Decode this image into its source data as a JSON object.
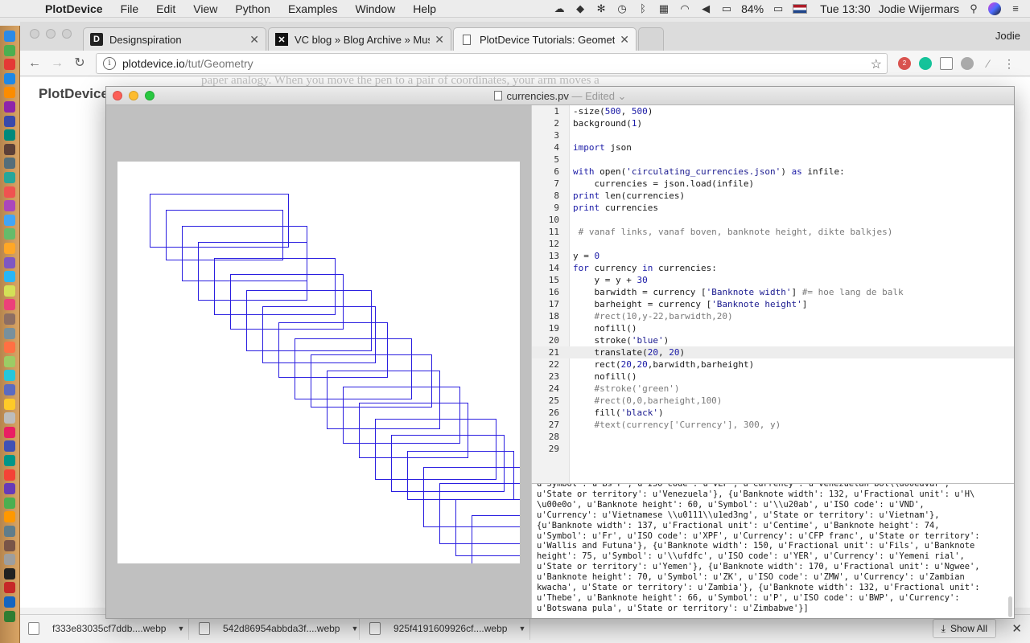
{
  "menubar": {
    "app_name": "PlotDevice",
    "menus": [
      "File",
      "Edit",
      "View",
      "Python",
      "Examples",
      "Window",
      "Help"
    ],
    "battery": "84%",
    "clock": "Tue 13:30",
    "user": "Jodie Wijermars"
  },
  "browser": {
    "tabs": [
      {
        "title": "Designspiration",
        "favicon": "D"
      },
      {
        "title": "VC blog » Blog Archive » Musi",
        "favicon": "✕"
      },
      {
        "title": "PlotDevice Tutorials: Geometry",
        "favicon": "doc"
      }
    ],
    "profile": "Jodie",
    "url_host": "plotdevice.io",
    "url_path": "/tut/Geometry",
    "badge": "2"
  },
  "webpage": {
    "logo": "PlotDevice",
    "background_text": "paper analogy. When you move the pen to a pair of coordinates, your arm moves a"
  },
  "plotdevice": {
    "filename": "currencies.pv",
    "edited_label": " — Edited",
    "code": [
      "-size(500, 500)",
      "background(1)",
      "",
      "import json",
      "",
      "with open('circulating_currencies.json') as infile:",
      "    currencies = json.load(infile)",
      "print len(currencies)",
      "print currencies",
      "",
      " # vanaf links, vanaf boven, banknote height, dikte balkjes)",
      "",
      "y = 0",
      "for currency in currencies:",
      "    y = y + 30",
      "    barwidth = currency ['Banknote width'] #= hoe lang de balk",
      "    barheight = currency ['Banknote height']",
      "    #rect(10,y-22,barwidth,20)",
      "    nofill()",
      "    stroke('blue')",
      "    translate(20, 20)",
      "    rect(20,20,barwidth,barheight)",
      "    nofill()",
      "    #stroke('green')",
      "    #rect(0,0,barheight,100)",
      "    fill('black')",
      "    #text(currency['Currency'], 300, y)",
      "",
      ""
    ],
    "highlight_line": 21,
    "console": [
      "u'Symbol': u'Bs F', u'ISO code': u'VEF', u'Currency': u'Venezuelan bol\\\\u00edvar',",
      "u'State or territory': u'Venezuela'}, {u'Banknote width': 132, u'Fractional unit': u'H\\",
      "\\u00e0o', u'Banknote height': 60, u'Symbol': u'\\\\u20ab', u'ISO code': u'VND',",
      "u'Currency': u'Vietnamese \\\\u0111\\\\u1ed3ng', u'State or territory': u'Vietnam'},",
      "{u'Banknote width': 137, u'Fractional unit': u'Centime', u'Banknote height': 74,",
      "u'Symbol': u'Fr', u'ISO code': u'XPF', u'Currency': u'CFP franc', u'State or territory':",
      "u'Wallis and Futuna'}, {u'Banknote width': 150, u'Fractional unit': u'Fils', u'Banknote",
      "height': 75, u'Symbol': u'\\\\ufdfc', u'ISO code': u'YER', u'Currency': u'Yemeni rial',",
      "u'State or territory': u'Yemen'}, {u'Banknote width': 170, u'Fractional unit': u'Ngwee',",
      "u'Banknote height': 70, u'Symbol': u'ZK', u'ISO code': u'ZMW', u'Currency': u'Zambian",
      "kwacha', u'State or territory': u'Zambia'}, {u'Banknote width': 132, u'Fractional unit':",
      "u'Thebe', u'Banknote height': 66, u'Symbol': u'P', u'ISO code': u'BWP', u'Currency':",
      "u'Botswana pula', u'State or territory': u'Zimbabwe'}]"
    ],
    "banknotes": [
      {
        "w": 172,
        "h": 66
      },
      {
        "w": 145,
        "h": 62
      },
      {
        "w": 155,
        "h": 68
      },
      {
        "w": 135,
        "h": 72
      },
      {
        "w": 150,
        "h": 70
      },
      {
        "w": 140,
        "h": 68
      },
      {
        "w": 155,
        "h": 75
      },
      {
        "w": 140,
        "h": 70
      },
      {
        "w": 135,
        "h": 68
      },
      {
        "w": 145,
        "h": 75
      },
      {
        "w": 150,
        "h": 65
      },
      {
        "w": 140,
        "h": 72
      },
      {
        "w": 145,
        "h": 70
      },
      {
        "w": 135,
        "h": 68
      },
      {
        "w": 150,
        "h": 75
      },
      {
        "w": 140,
        "h": 70
      },
      {
        "w": 132,
        "h": 60
      },
      {
        "w": 137,
        "h": 74
      },
      {
        "w": 150,
        "h": 75
      },
      {
        "w": 170,
        "h": 70
      },
      {
        "w": 132,
        "h": 66
      }
    ],
    "stroke_color": "#2a1ee0"
  },
  "downloads": {
    "items": [
      "f333e83035cf7ddb....webp",
      "542d86954abbda3f....webp",
      "925f4191609926cf....webp"
    ],
    "show_all": "Show All"
  },
  "colors": {
    "menubar": "#ececec",
    "dock": "#c9955a"
  }
}
